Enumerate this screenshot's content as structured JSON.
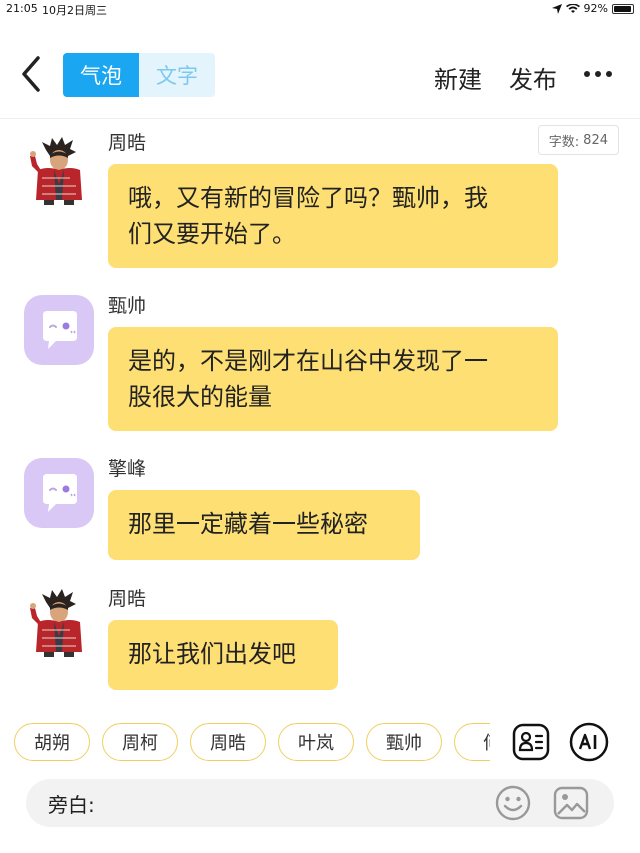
{
  "status_bar": {
    "time": "21:05",
    "date": "10月2日周三",
    "battery": "92%",
    "battery_level": 0.92
  },
  "nav": {
    "tabs": [
      {
        "label": "气泡",
        "active": true
      },
      {
        "label": "文字",
        "active": false
      }
    ],
    "new_label": "新建",
    "publish_label": "发布"
  },
  "word_count": {
    "label": "字数:",
    "value": "824"
  },
  "messages": [
    {
      "speaker": "周晧",
      "avatar": "character-portrait",
      "text_lines": [
        "哦，又有新的冒险了吗？甄帅，我",
        "们又要开始了。"
      ]
    },
    {
      "speaker": "甄帅",
      "avatar": "chat-bubble-face-icon",
      "text_lines": [
        "是的，不是刚才在山谷中发现了一",
        "股很大的能量"
      ]
    },
    {
      "speaker": "擎峰",
      "avatar": "chat-bubble-face-icon",
      "text_lines": [
        "那里一定藏着一些秘密"
      ]
    },
    {
      "speaker": "周晧",
      "avatar": "character-portrait",
      "text_lines": [
        "那让我们出发吧"
      ]
    }
  ],
  "characters": [
    "胡朔",
    "周柯",
    "周晧",
    "叶岚",
    "甄帅",
    "何"
  ],
  "input": {
    "label": "旁白:"
  },
  "colors": {
    "accent": "#1aa6f0",
    "bubble": "#fddf74",
    "chip_border": "#f1cf5f",
    "bot_avatar": "#d9c8f5"
  }
}
